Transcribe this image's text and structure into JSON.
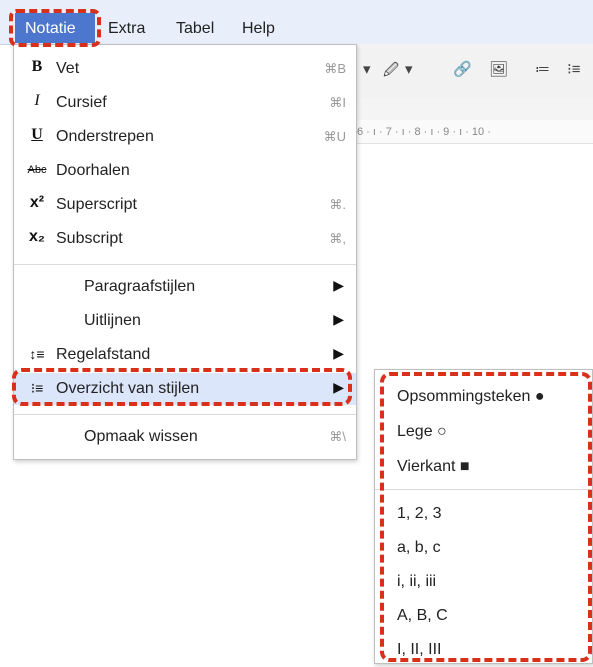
{
  "menubar": {
    "items": [
      "Notatie",
      "Extra",
      "Tabel",
      "Help"
    ]
  },
  "toolbar": {
    "glyphs": [
      "▾",
      "🖉",
      "▾",
      "🔗",
      "🖼",
      "≔",
      "⁝≡"
    ]
  },
  "ruler": {
    "text": "6 · ı · 7 · ı · 8 · ı · 9 · ı · 10 ·"
  },
  "main_menu": {
    "items": [
      {
        "icon": "bold-icon",
        "glyph": "B",
        "label": "Vet",
        "shortcut": "⌘B"
      },
      {
        "icon": "italic-icon",
        "glyph": "I",
        "label": "Cursief",
        "shortcut": "⌘I"
      },
      {
        "icon": "underline-icon",
        "glyph": "U",
        "label": "Onderstrepen",
        "shortcut": "⌘U"
      },
      {
        "icon": "strikethrough-icon",
        "glyph": "Abc",
        "label": "Doorhalen",
        "shortcut": ""
      },
      {
        "icon": "superscript-icon",
        "glyph": "x²",
        "label": "Superscript",
        "shortcut": "⌘."
      },
      {
        "icon": "subscript-icon",
        "glyph": "x₂",
        "label": "Subscript",
        "shortcut": "⌘,"
      },
      {
        "label": "Paragraafstijlen",
        "arrow": "▶"
      },
      {
        "label": "Uitlijnen",
        "arrow": "▶"
      },
      {
        "icon": "line-spacing-icon",
        "glyph": "↕≡",
        "label": "Regelafstand",
        "arrow": "▶"
      },
      {
        "icon": "bulleted-list-icon",
        "glyph": "⁝≡",
        "label": "Overzicht van stijlen",
        "arrow": "▶"
      },
      {
        "label": "Opmaak wissen",
        "shortcut": "⌘\\"
      }
    ]
  },
  "sub_menu": {
    "items": [
      "Opsommingsteken ●",
      "Lege ○",
      "Vierkant ■",
      "1, 2, 3",
      "a, b, c",
      "i, ii, iii",
      "A, B, C",
      "I, II, III"
    ]
  },
  "colors": {
    "accent": "#4d77cf",
    "highlight": "#dce6fa",
    "annotation": "#d9301b",
    "menubar_bg": "#e8eefa"
  }
}
